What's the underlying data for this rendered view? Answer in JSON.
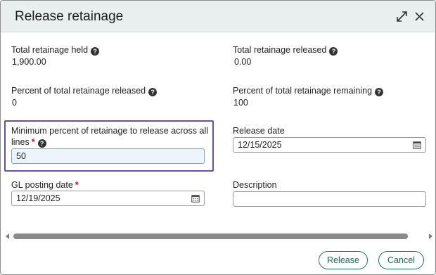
{
  "dialog": {
    "title": "Release retainage",
    "expand_icon": "expand-icon",
    "close_icon": "close-icon"
  },
  "fields": {
    "total_held": {
      "label": "Total retainage held",
      "value": "1,900.00"
    },
    "total_released": {
      "label": "Total retainage released",
      "value": "0.00"
    },
    "pct_released": {
      "label": "Percent of total retainage released",
      "value": "0"
    },
    "pct_remaining": {
      "label": "Percent of total retainage remaining",
      "value": "100"
    },
    "min_percent": {
      "label_line1": "Minimum percent of retainage to release across all",
      "label_line2": "lines",
      "required_mark": "*",
      "value": "50"
    },
    "release_date": {
      "label": "Release date",
      "value": "12/15/2025"
    },
    "gl_posting_date": {
      "label": "GL posting date",
      "required_mark": "*",
      "value": "12/19/2025"
    },
    "description": {
      "label": "Description",
      "value": ""
    }
  },
  "help_glyph": "?",
  "buttons": {
    "release": "Release",
    "cancel": "Cancel"
  },
  "colors": {
    "header_bg": "#e9eeef",
    "highlight_border": "#6b4fa8",
    "button_border": "#1b7a5a",
    "required": "#c8102e"
  }
}
